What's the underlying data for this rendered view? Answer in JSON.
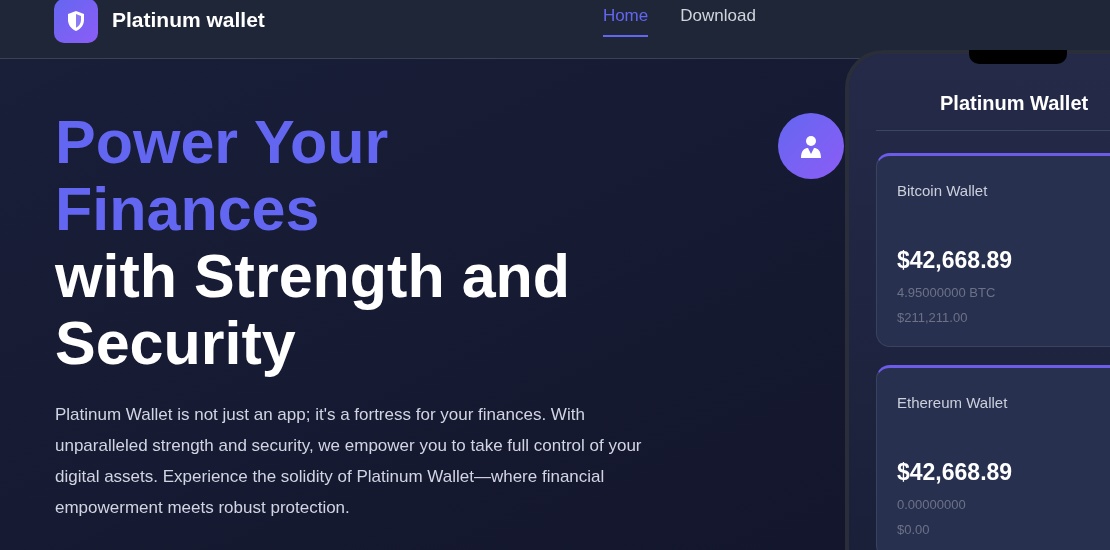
{
  "header": {
    "brand": "Platinum wallet",
    "nav": [
      {
        "label": "Home",
        "selected": true
      },
      {
        "label": "Download",
        "selected": false
      }
    ]
  },
  "hero": {
    "headline_accent": "Power Your Finances",
    "headline_rest": "with Strength and Security",
    "description": "Platinum Wallet is not just an app; it's a fortress for your finances. With unparalleled strength and security, we empower you to take full control of your digital assets. Experience the solidity of Platinum Wallet—where financial empowerment meets robust protection."
  },
  "phone": {
    "title": "Platinum Wallet",
    "wallets": [
      {
        "name": "Bitcoin Wallet",
        "balance": "$42,668.89",
        "amount": "4.95000000 BTC",
        "value": "$211,211.00"
      },
      {
        "name": "Ethereum Wallet",
        "balance": "$42,668.89",
        "amount": "0.00000000",
        "value": "$0.00"
      }
    ]
  }
}
